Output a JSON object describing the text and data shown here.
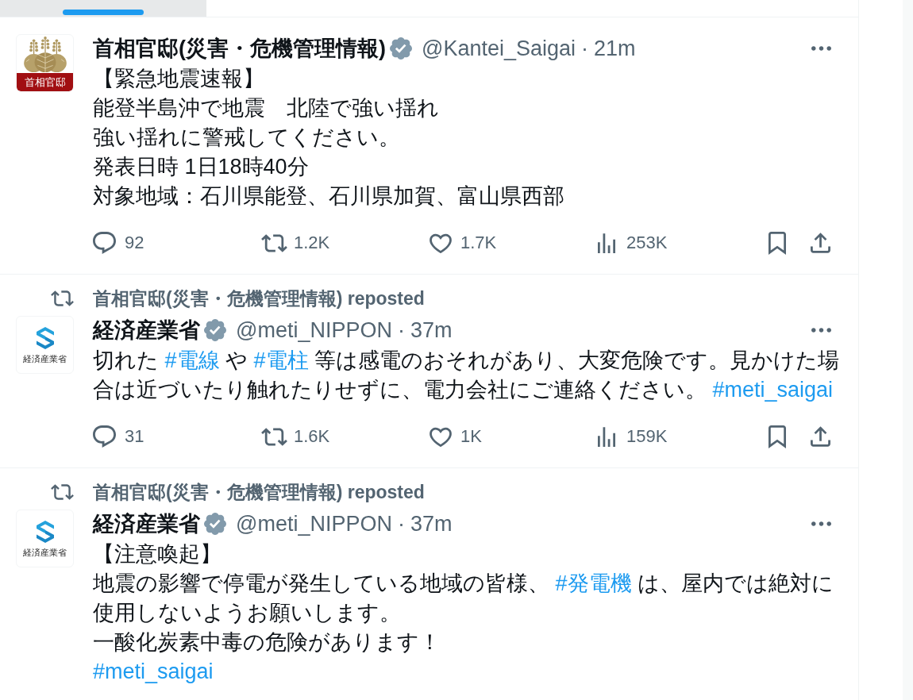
{
  "tabs": [
    {
      "selected": true,
      "hovered": true
    }
  ],
  "tweets": [
    {
      "avatar": {
        "kind": "crest",
        "caption": "首相官邸"
      },
      "name": "首相官邸(災害・危機管理情報)",
      "verified": true,
      "handle": "@Kantei_Saigai",
      "separator": "·",
      "time": "21m",
      "lines": [
        [
          {
            "kind": "text",
            "text": "【緊急地震速報】"
          }
        ],
        [
          {
            "kind": "text",
            "text": "能登半島沖で地震　北陸で強い揺れ"
          }
        ],
        [
          {
            "kind": "text",
            "text": "強い揺れに警戒してください。"
          }
        ],
        [
          {
            "kind": "text",
            "text": "発表日時 1日18時40分"
          }
        ],
        [
          {
            "kind": "text",
            "text": "対象地域：石川県能登、石川県加賀、富山県西部"
          }
        ]
      ],
      "stats": [
        {
          "kind": "reply",
          "count": "92"
        },
        {
          "kind": "repost",
          "count": "1.2K"
        },
        {
          "kind": "like",
          "count": "1.7K"
        },
        {
          "kind": "views",
          "count": "253K"
        }
      ]
    },
    {
      "repost_label": "首相官邸(災害・危機管理情報) reposted",
      "avatar": {
        "kind": "s-mark",
        "caption": "経済産業省"
      },
      "name": "経済産業省",
      "verified": true,
      "handle": "@meti_NIPPON",
      "separator": "·",
      "time": "37m",
      "lines": [
        [
          {
            "kind": "text",
            "text": "切れた "
          },
          {
            "kind": "hashtag",
            "text": "#電線"
          },
          {
            "kind": "text",
            "text": " や "
          },
          {
            "kind": "hashtag",
            "text": "#電柱"
          },
          {
            "kind": "text",
            "text": " 等は感電のおそれがあり、大変危険です。見かけた場合は近づいたり触れたりせずに、電力会社にご連絡ください。 "
          },
          {
            "kind": "hashtag",
            "text": "#meti_saigai"
          }
        ]
      ],
      "stats": [
        {
          "kind": "reply",
          "count": "31"
        },
        {
          "kind": "repost",
          "count": "1.6K"
        },
        {
          "kind": "like",
          "count": "1K"
        },
        {
          "kind": "views",
          "count": "159K"
        }
      ]
    },
    {
      "repost_label": "首相官邸(災害・危機管理情報) reposted",
      "avatar": {
        "kind": "s-mark",
        "caption": "経済産業省"
      },
      "name": "経済産業省",
      "verified": true,
      "handle": "@meti_NIPPON",
      "separator": "·",
      "time": "37m",
      "lines": [
        [
          {
            "kind": "text",
            "text": "【注意喚起】"
          }
        ],
        [
          {
            "kind": "text",
            "text": "地震の影響で停電が発生している地域の皆様、 "
          },
          {
            "kind": "hashtag",
            "text": "#発電機"
          },
          {
            "kind": "text",
            "text": " は、屋内では絶対に使用しないようお願いします。"
          }
        ],
        [
          {
            "kind": "text",
            "text": "一酸化炭素中毒の危険があります！"
          }
        ],
        [
          {
            "kind": "hashtag",
            "text": "#meti_saigai"
          }
        ]
      ]
    }
  ]
}
